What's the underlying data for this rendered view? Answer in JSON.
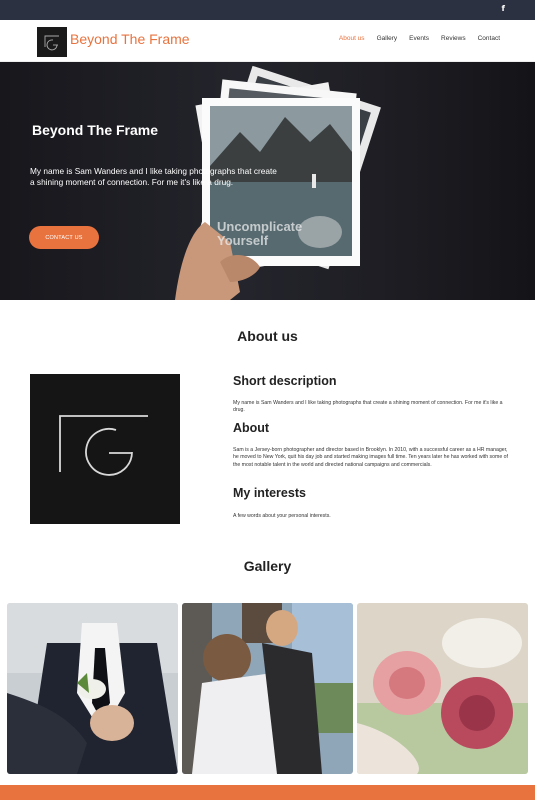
{
  "topbar": {
    "social_icon": "facebook-icon",
    "social_glyph": "f"
  },
  "header": {
    "site_title": "Beyond The Frame",
    "nav": [
      "About us",
      "Gallery",
      "Events",
      "Reviews",
      "Contact"
    ],
    "active_nav": "About us"
  },
  "hero": {
    "title": "Beyond The Frame",
    "text": "My name is Sam Wanders and I like taking photographs that create a shining moment of connection. For me it's like a drug.",
    "button": "CONTACT US",
    "photo_caption": "Uncomplicate Yourself"
  },
  "about": {
    "heading": "About us",
    "short_title": "Short description",
    "short_text": "My name is Sam Wanders and I like taking photographs that create a shining moment of connection. For me it's like a drug.",
    "about_title": "About",
    "about_text": "Sam is a Jersey-born photographer and director based in Brooklyn. In 2010, with a successful career as a HR manager, he moved to New York, quit his day job and started making images full time. Ten years later he has worked with some of the most notable talent in the world and directed national campaigns and commercials.",
    "interests_title": "My interests",
    "interests_text": "A few words about your personal interests."
  },
  "gallery": {
    "heading": "Gallery"
  },
  "colors": {
    "accent": "#e8733e",
    "topbar": "#2b3140",
    "hero_bg": "#1c1c22"
  }
}
